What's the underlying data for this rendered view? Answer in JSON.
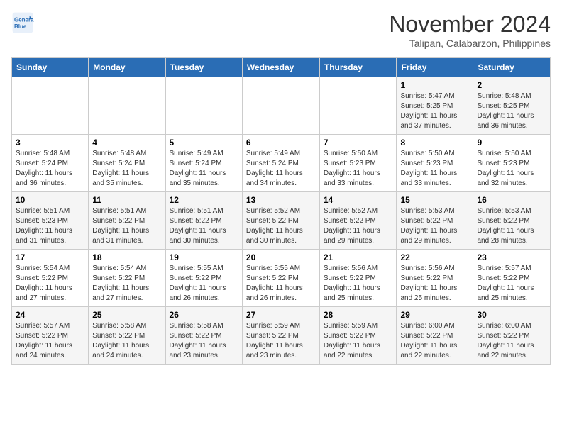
{
  "header": {
    "logo_line1": "General",
    "logo_line2": "Blue",
    "month": "November 2024",
    "location": "Talipan, Calabarzon, Philippines"
  },
  "weekdays": [
    "Sunday",
    "Monday",
    "Tuesday",
    "Wednesday",
    "Thursday",
    "Friday",
    "Saturday"
  ],
  "weeks": [
    [
      {
        "day": "",
        "info": ""
      },
      {
        "day": "",
        "info": ""
      },
      {
        "day": "",
        "info": ""
      },
      {
        "day": "",
        "info": ""
      },
      {
        "day": "",
        "info": ""
      },
      {
        "day": "1",
        "info": "Sunrise: 5:47 AM\nSunset: 5:25 PM\nDaylight: 11 hours and 37 minutes."
      },
      {
        "day": "2",
        "info": "Sunrise: 5:48 AM\nSunset: 5:25 PM\nDaylight: 11 hours and 36 minutes."
      }
    ],
    [
      {
        "day": "3",
        "info": "Sunrise: 5:48 AM\nSunset: 5:24 PM\nDaylight: 11 hours and 36 minutes."
      },
      {
        "day": "4",
        "info": "Sunrise: 5:48 AM\nSunset: 5:24 PM\nDaylight: 11 hours and 35 minutes."
      },
      {
        "day": "5",
        "info": "Sunrise: 5:49 AM\nSunset: 5:24 PM\nDaylight: 11 hours and 35 minutes."
      },
      {
        "day": "6",
        "info": "Sunrise: 5:49 AM\nSunset: 5:24 PM\nDaylight: 11 hours and 34 minutes."
      },
      {
        "day": "7",
        "info": "Sunrise: 5:50 AM\nSunset: 5:23 PM\nDaylight: 11 hours and 33 minutes."
      },
      {
        "day": "8",
        "info": "Sunrise: 5:50 AM\nSunset: 5:23 PM\nDaylight: 11 hours and 33 minutes."
      },
      {
        "day": "9",
        "info": "Sunrise: 5:50 AM\nSunset: 5:23 PM\nDaylight: 11 hours and 32 minutes."
      }
    ],
    [
      {
        "day": "10",
        "info": "Sunrise: 5:51 AM\nSunset: 5:23 PM\nDaylight: 11 hours and 31 minutes."
      },
      {
        "day": "11",
        "info": "Sunrise: 5:51 AM\nSunset: 5:22 PM\nDaylight: 11 hours and 31 minutes."
      },
      {
        "day": "12",
        "info": "Sunrise: 5:51 AM\nSunset: 5:22 PM\nDaylight: 11 hours and 30 minutes."
      },
      {
        "day": "13",
        "info": "Sunrise: 5:52 AM\nSunset: 5:22 PM\nDaylight: 11 hours and 30 minutes."
      },
      {
        "day": "14",
        "info": "Sunrise: 5:52 AM\nSunset: 5:22 PM\nDaylight: 11 hours and 29 minutes."
      },
      {
        "day": "15",
        "info": "Sunrise: 5:53 AM\nSunset: 5:22 PM\nDaylight: 11 hours and 29 minutes."
      },
      {
        "day": "16",
        "info": "Sunrise: 5:53 AM\nSunset: 5:22 PM\nDaylight: 11 hours and 28 minutes."
      }
    ],
    [
      {
        "day": "17",
        "info": "Sunrise: 5:54 AM\nSunset: 5:22 PM\nDaylight: 11 hours and 27 minutes."
      },
      {
        "day": "18",
        "info": "Sunrise: 5:54 AM\nSunset: 5:22 PM\nDaylight: 11 hours and 27 minutes."
      },
      {
        "day": "19",
        "info": "Sunrise: 5:55 AM\nSunset: 5:22 PM\nDaylight: 11 hours and 26 minutes."
      },
      {
        "day": "20",
        "info": "Sunrise: 5:55 AM\nSunset: 5:22 PM\nDaylight: 11 hours and 26 minutes."
      },
      {
        "day": "21",
        "info": "Sunrise: 5:56 AM\nSunset: 5:22 PM\nDaylight: 11 hours and 25 minutes."
      },
      {
        "day": "22",
        "info": "Sunrise: 5:56 AM\nSunset: 5:22 PM\nDaylight: 11 hours and 25 minutes."
      },
      {
        "day": "23",
        "info": "Sunrise: 5:57 AM\nSunset: 5:22 PM\nDaylight: 11 hours and 25 minutes."
      }
    ],
    [
      {
        "day": "24",
        "info": "Sunrise: 5:57 AM\nSunset: 5:22 PM\nDaylight: 11 hours and 24 minutes."
      },
      {
        "day": "25",
        "info": "Sunrise: 5:58 AM\nSunset: 5:22 PM\nDaylight: 11 hours and 24 minutes."
      },
      {
        "day": "26",
        "info": "Sunrise: 5:58 AM\nSunset: 5:22 PM\nDaylight: 11 hours and 23 minutes."
      },
      {
        "day": "27",
        "info": "Sunrise: 5:59 AM\nSunset: 5:22 PM\nDaylight: 11 hours and 23 minutes."
      },
      {
        "day": "28",
        "info": "Sunrise: 5:59 AM\nSunset: 5:22 PM\nDaylight: 11 hours and 22 minutes."
      },
      {
        "day": "29",
        "info": "Sunrise: 6:00 AM\nSunset: 5:22 PM\nDaylight: 11 hours and 22 minutes."
      },
      {
        "day": "30",
        "info": "Sunrise: 6:00 AM\nSunset: 5:22 PM\nDaylight: 11 hours and 22 minutes."
      }
    ]
  ]
}
